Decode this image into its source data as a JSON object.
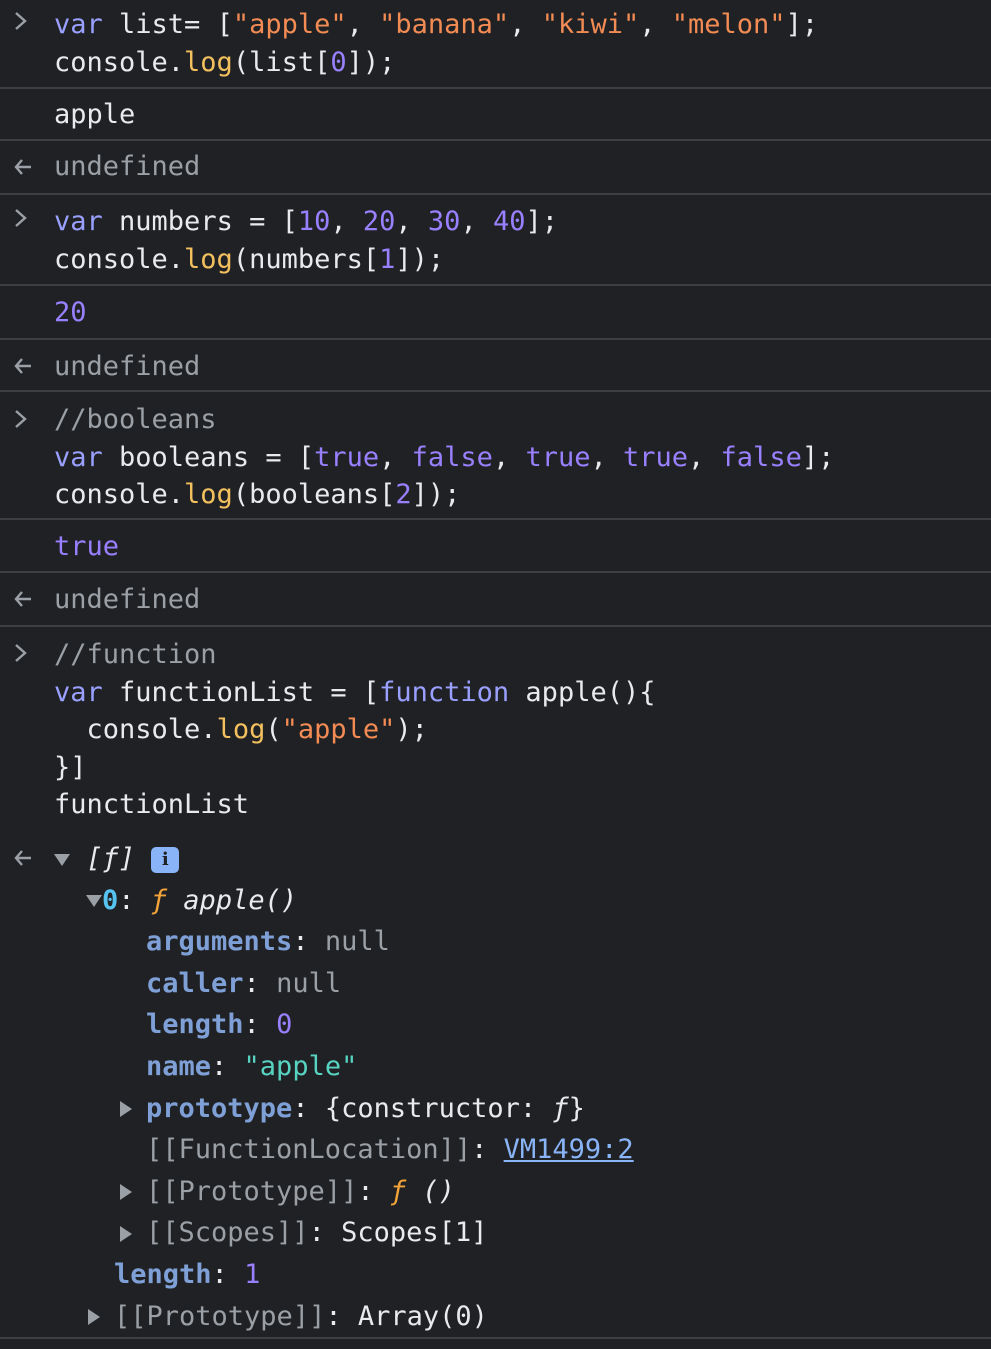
{
  "entries": {
    "e1": {
      "code": {
        "l1": {
          "kw": "var",
          "t1": " list= [",
          "s1": "\"apple\"",
          "c1": ", ",
          "s2": "\"banana\"",
          "c2": ", ",
          "s3": "\"kiwi\"",
          "c3": ", ",
          "s4": "\"melon\"",
          "t2": "];"
        },
        "l2": {
          "t1": "console.",
          "fn": "log",
          "t2": "(list[",
          "n": "0",
          "t3": "]);"
        }
      },
      "output": "apple",
      "result": "undefined"
    },
    "e2": {
      "code": {
        "l1": {
          "kw": "var",
          "t1": " numbers = [",
          "n1": "10",
          "c1": ", ",
          "n2": "20",
          "c2": ", ",
          "n3": "30",
          "c3": ", ",
          "n4": "40",
          "t2": "];"
        },
        "l2": {
          "t1": "console.",
          "fn": "log",
          "t2": "(numbers[",
          "n": "1",
          "t3": "]);"
        }
      },
      "output": "20",
      "result": "undefined"
    },
    "e3": {
      "code": {
        "l0": "//booleans",
        "l1": {
          "kw": "var",
          "t1": " booleans = [",
          "b1": "true",
          "c1": ", ",
          "b2": "false",
          "c2": ", ",
          "b3": "true",
          "c3": ", ",
          "b4": "true",
          "c4": ", ",
          "b5": "false",
          "t2": "];"
        },
        "l2": {
          "t1": "console.",
          "fn": "log",
          "t2": "(booleans[",
          "n": "2",
          "t3": "]);"
        }
      },
      "output": "true",
      "result": "undefined"
    },
    "e4": {
      "code": {
        "l0": "//function",
        "l1": {
          "kw": "var",
          "t1": " functionList = [",
          "kw2": "function",
          "t2": " apple(){"
        },
        "l2": {
          "t1": "  console.",
          "fn": "log",
          "t2": "(",
          "s": "\"apple\"",
          "t3": ");"
        },
        "l3": "}]",
        "l4": "functionList"
      }
    }
  },
  "tree": {
    "root_label": "[ƒ]",
    "info_icon": "i",
    "item0": {
      "key": "0",
      "sep": ": ",
      "f": "ƒ",
      "sig": " apple()"
    },
    "arguments": {
      "key": "arguments",
      "sep": ": ",
      "val": "null"
    },
    "caller": {
      "key": "caller",
      "sep": ": ",
      "val": "null"
    },
    "length0": {
      "key": "length",
      "sep": ": ",
      "val": "0"
    },
    "name": {
      "key": "name",
      "sep": ": ",
      "val": "\"apple\""
    },
    "prototype": {
      "key": "prototype",
      "sep": ": ",
      "o1": "{constructor: ",
      "f": "ƒ",
      "o2": "}"
    },
    "location": {
      "key": "[[FunctionLocation]]",
      "sep": ": ",
      "link": "VM1499:2"
    },
    "fproto": {
      "key": "[[Prototype]]",
      "sep": ": ",
      "f": "ƒ",
      "val": " ()"
    },
    "scopes": {
      "key": "[[Scopes]]",
      "sep": ": ",
      "val": "Scopes[1]"
    },
    "length1": {
      "key": "length",
      "sep": ": ",
      "val": "1"
    },
    "aproto": {
      "key": "[[Prototype]]",
      "sep": ": ",
      "val": "Array(0)"
    }
  }
}
